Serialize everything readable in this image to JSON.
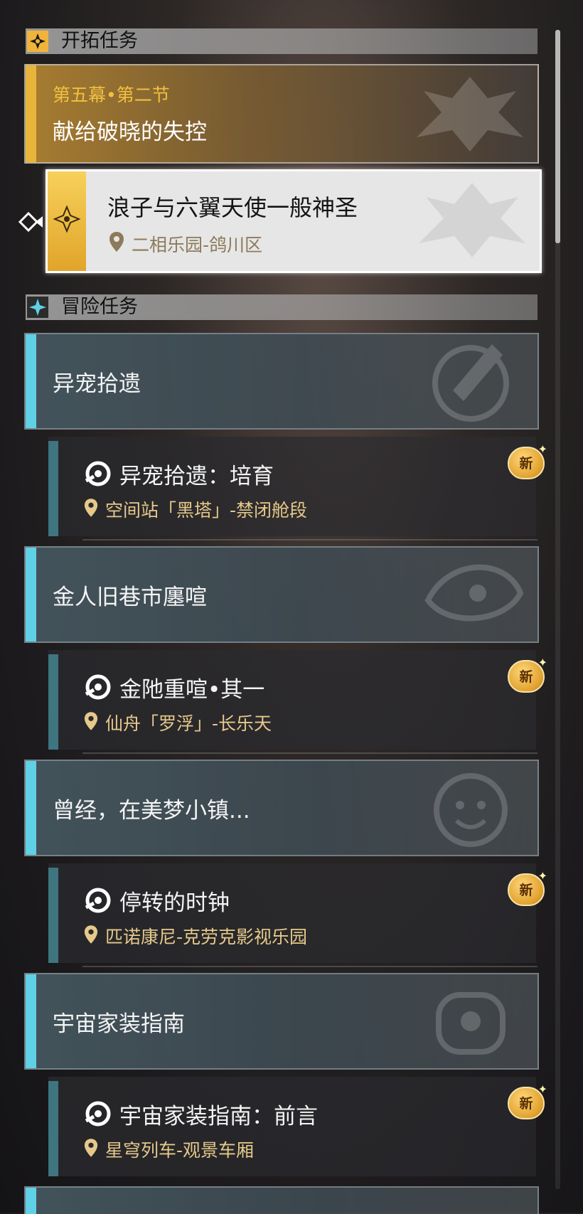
{
  "sections": {
    "trailblaze": {
      "title": "开拓任务"
    },
    "adventure": {
      "title": "冒险任务"
    }
  },
  "main_quest": {
    "chapter": "第五幕•第二节",
    "name": "献给破晓的失控"
  },
  "active_quest": {
    "name": "浪子与六翼天使一般神圣",
    "location": "二相乐园-鸽川区"
  },
  "adventure_quests": [
    {
      "category": "异宠拾遗",
      "quest": "异宠拾遗：培育",
      "location": "空间站「黑塔」-禁闭舱段",
      "badge": "新"
    },
    {
      "category": "金人旧巷市廛喧",
      "quest": "金阤重喧•其一",
      "location": "仙舟「罗浮」-长乐天",
      "badge": "新"
    },
    {
      "category": "曾经，在美梦小镇...",
      "quest": "停转的时钟",
      "location": "匹诺康尼-克劳克影视乐园",
      "badge": "新"
    },
    {
      "category": "宇宙家装指南",
      "quest": "宇宙家装指南：前言",
      "location": "星穹列车-观景车厢",
      "badge": "新"
    }
  ],
  "colors": {
    "gold": "#e8b53a",
    "cyan": "#5fd0e6",
    "location": "#e6c98a"
  }
}
